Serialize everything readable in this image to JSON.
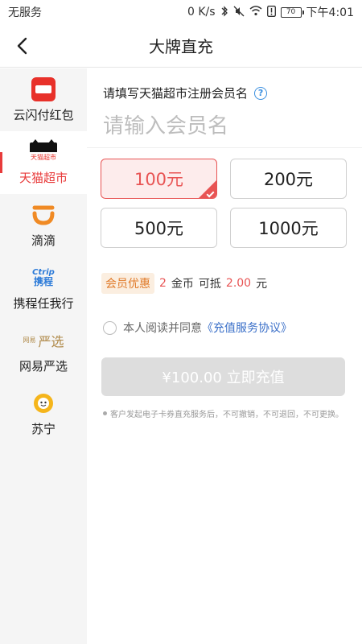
{
  "status_bar": {
    "carrier": "无服务",
    "speed": "0 K/s",
    "battery": "70",
    "time": "下午4:01"
  },
  "header": {
    "title": "大牌直充"
  },
  "sidebar": {
    "items": [
      {
        "label": "云闪付红包",
        "icon": "unionpay-red-packet-icon",
        "active": false
      },
      {
        "label": "天猫超市",
        "icon": "tmall-icon",
        "logo_text": "天猫超市",
        "active": true
      },
      {
        "label": "滴滴",
        "icon": "didi-icon",
        "active": false
      },
      {
        "label": "携程任我行",
        "icon": "ctrip-icon",
        "logo_en": "Ctrip",
        "logo_zh": "携程",
        "active": false
      },
      {
        "label": "网易严选",
        "icon": "netease-yanxuan-icon",
        "logo_small": "网易",
        "logo_big": "严选",
        "active": false
      },
      {
        "label": "苏宁",
        "icon": "suning-icon",
        "active": false
      }
    ]
  },
  "form": {
    "title": "请填写天猫超市注册会员名",
    "help_symbol": "?",
    "input_placeholder": "请输入会员名",
    "input_value": ""
  },
  "amounts": {
    "options": [
      "100元",
      "200元",
      "500元",
      "1000元"
    ],
    "selected_index": 0
  },
  "promo": {
    "badge": "会员优惠",
    "coins": "2",
    "coin_unit": "金币",
    "deduct_text": "可抵",
    "deduct_amount": "2.00",
    "currency": "元"
  },
  "agreement": {
    "text": "本人阅读并同意",
    "link": "《充值服务协议》",
    "checked": false
  },
  "submit": {
    "label": "¥100.00 立即充值",
    "enabled": false
  },
  "notice": {
    "text": "客户发起电子卡券直充服务后，不可撤销，不可退回，不可更换。"
  },
  "colors": {
    "accent_red": "#e85454",
    "link_blue": "#3a6fc8",
    "promo_orange": "#e07b2a",
    "disabled_gray": "#dddddd"
  }
}
